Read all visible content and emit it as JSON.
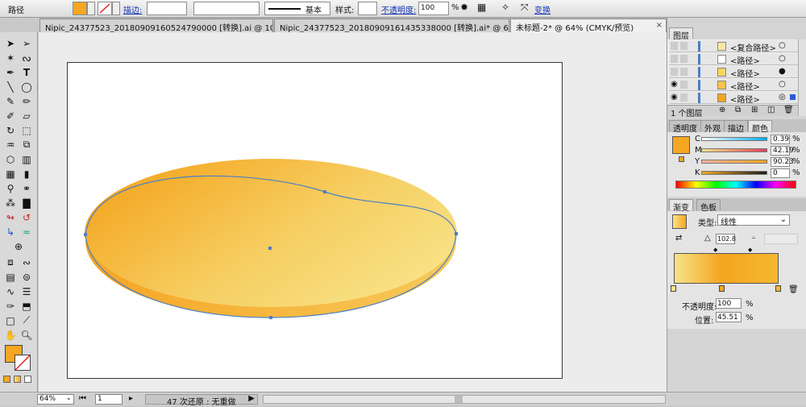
{
  "control_bar": {
    "object_type": "路径",
    "stroke_label": "描边:",
    "stroke_style": "基本",
    "style_label": "样式:",
    "opacity_label": "不透明度:",
    "opacity_value": "100",
    "opacity_unit": "%",
    "transform_label": "变换"
  },
  "tabs": [
    {
      "label": "Nipic_24377523_20180909160524790000 [转换].ai @ 10..."
    },
    {
      "label": "Nipic_24377523_20180909161435338000 [转换].ai* @ 6..."
    },
    {
      "label": "未标题-2* @ 64% (CMYK/预览)"
    }
  ],
  "layers_panel": {
    "title": "图层",
    "items": [
      {
        "label": "<复合路径>"
      },
      {
        "label": "<路径>"
      },
      {
        "label": "<路径>"
      },
      {
        "label": "<路径>"
      },
      {
        "label": "<路径>"
      }
    ],
    "footer": "1 个图层"
  },
  "color_panel": {
    "tabs": [
      "透明度",
      "外观",
      "描边",
      "颜色"
    ],
    "channels": [
      {
        "name": "C",
        "value": "0.39"
      },
      {
        "name": "M",
        "value": "42.19"
      },
      {
        "name": "Y",
        "value": "90.23"
      },
      {
        "name": "K",
        "value": "0"
      }
    ],
    "channel_unit": "%"
  },
  "gradient_panel": {
    "tabs": [
      "渐变",
      "色板"
    ],
    "type_label": "类型:",
    "type_value": "线性",
    "angle_value": "102.8",
    "opacity_label": "不透明度:",
    "opacity_value": "100",
    "position_label": "位置:",
    "position_value": "45.51",
    "unit": "%"
  },
  "status_bar": {
    "zoom": "64%",
    "page": "1",
    "info": "47 次还原 : 无重做"
  },
  "colors": {
    "fill": "#f5a623",
    "gradient_start": "#f7e38a",
    "gradient_end": "#f4a51f",
    "path_blue": "#4a7ec7"
  }
}
